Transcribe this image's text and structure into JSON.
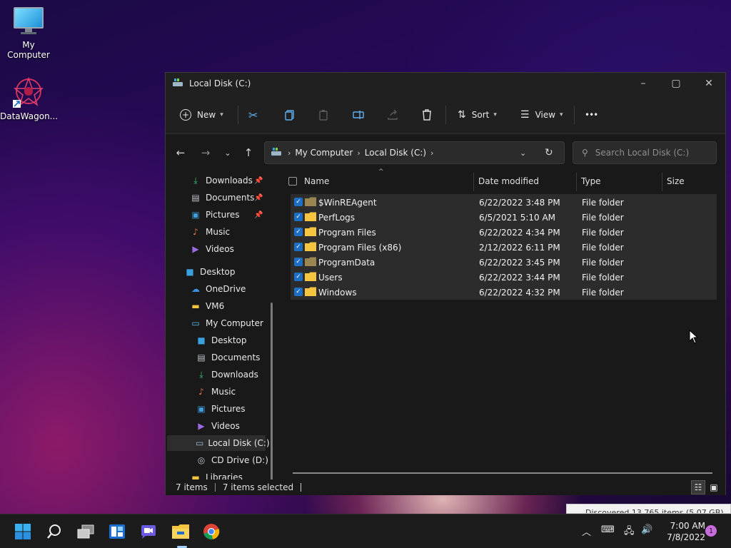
{
  "desktop": {
    "icons": [
      {
        "label": "My Computer",
        "icon": "monitor-icon"
      },
      {
        "label": "DataWagon...",
        "icon": "datawagon-shortcut-icon"
      }
    ]
  },
  "window": {
    "title": "Local Disk (C:)",
    "controls": {
      "minimize": "–",
      "maximize": "▢",
      "close": "✕"
    }
  },
  "toolbar": {
    "new_label": "New",
    "sort_label": "Sort",
    "view_label": "View",
    "more_label": "•••"
  },
  "address": {
    "crumbs": [
      "My Computer",
      "Local Disk (C:)"
    ],
    "search_placeholder": "Search Local Disk (C:)"
  },
  "nav": {
    "quick_access": [
      {
        "label": "Downloads",
        "pinned": true
      },
      {
        "label": "Documents",
        "pinned": true
      },
      {
        "label": "Pictures",
        "pinned": true
      },
      {
        "label": "Music",
        "pinned": false
      },
      {
        "label": "Videos",
        "pinned": false
      }
    ],
    "desktop": "Desktop",
    "onedrive": "OneDrive",
    "vm6": "VM6",
    "my_computer": "My Computer",
    "computer_items": [
      "Desktop",
      "Documents",
      "Downloads",
      "Music",
      "Pictures",
      "Videos",
      "Local Disk (C:)",
      "CD Drive (D:)"
    ],
    "libraries": "Libraries"
  },
  "columns": {
    "name": "Name",
    "date": "Date modified",
    "type": "Type",
    "size": "Size"
  },
  "files": [
    {
      "name": "$WinREAgent",
      "date": "6/22/2022 3:48 PM",
      "type": "File folder",
      "dim": true
    },
    {
      "name": "PerfLogs",
      "date": "6/5/2021 5:10 AM",
      "type": "File folder",
      "dim": false
    },
    {
      "name": "Program Files",
      "date": "6/22/2022 4:34 PM",
      "type": "File folder",
      "dim": false
    },
    {
      "name": "Program Files (x86)",
      "date": "2/12/2022 6:11 PM",
      "type": "File folder",
      "dim": false
    },
    {
      "name": "ProgramData",
      "date": "6/22/2022 3:45 PM",
      "type": "File folder",
      "dim": true
    },
    {
      "name": "Users",
      "date": "6/22/2022 3:44 PM",
      "type": "File folder",
      "dim": false
    },
    {
      "name": "Windows",
      "date": "6/22/2022 4:32 PM",
      "type": "File folder",
      "dim": false
    }
  ],
  "status": {
    "items": "7 items",
    "selected": "7 items selected"
  },
  "toast": {
    "text": "Discovered 13,765 items (5.07 GB)"
  },
  "taskbar": {
    "clock_time": "7:00 AM",
    "clock_date": "7/8/2022",
    "notification_count": "1"
  },
  "colors": {
    "accent": "#1e6fc4",
    "folder": "#f5c542",
    "window_bg": "#191919"
  }
}
